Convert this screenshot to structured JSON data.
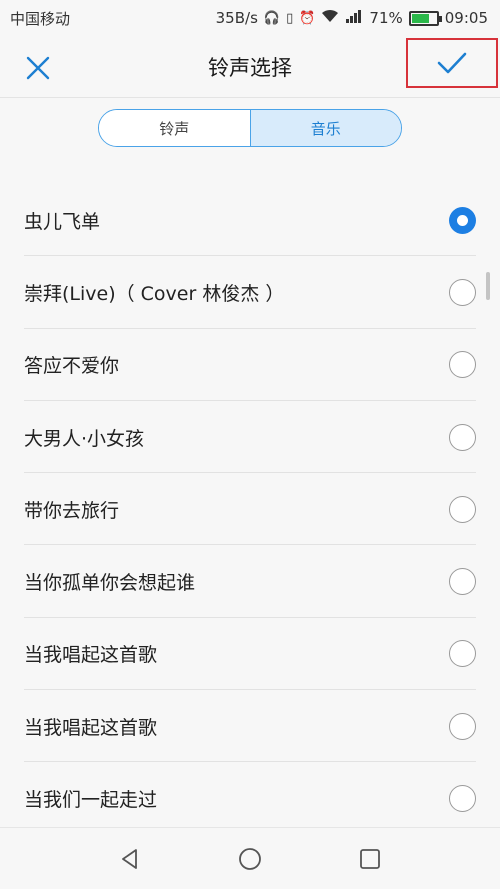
{
  "status_bar": {
    "carrier": "中国移动",
    "net_speed": "35B/s",
    "battery_text": "71%",
    "battery_level": 0.71,
    "time": "09:05"
  },
  "header": {
    "title": "铃声选择",
    "close_icon": "close-icon",
    "confirm_icon": "check-icon"
  },
  "tabs": [
    {
      "label": "铃声",
      "active": false
    },
    {
      "label": "音乐",
      "active": true
    }
  ],
  "songs": [
    {
      "title": "虫儿飞单",
      "selected": true
    },
    {
      "title": "崇拜(Live)（ Cover 林俊杰 ）",
      "selected": false
    },
    {
      "title": "答应不爱你",
      "selected": false
    },
    {
      "title": "大男人·小女孩",
      "selected": false
    },
    {
      "title": "带你去旅行",
      "selected": false
    },
    {
      "title": "当你孤单你会想起谁",
      "selected": false
    },
    {
      "title": "当我唱起这首歌",
      "selected": false
    },
    {
      "title": "当我唱起这首歌",
      "selected": false
    },
    {
      "title": "当我们一起走过",
      "selected": false
    }
  ],
  "colors": {
    "accent": "#1d7fe3",
    "highlight_border": "#d7323a"
  }
}
